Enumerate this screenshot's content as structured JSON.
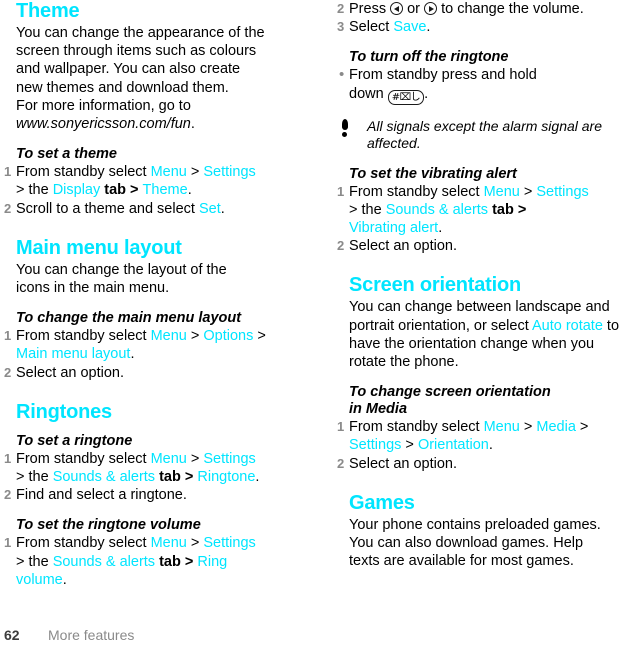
{
  "accent_color": "#00e5ff",
  "muted_color": "#8a8a8a",
  "footer": {
    "page_number": "62",
    "section_label": "More features"
  },
  "left_column": {
    "theme": {
      "heading": "Theme",
      "body_lines": [
        "You can change the appearance of the",
        "screen through items such as colours",
        "and wallpaper. You can also create",
        "new themes and download them.",
        "For more information, go to"
      ],
      "url": "www.sonyericsson.com/fun",
      "url_trailing": ".",
      "task_title": "To set a theme",
      "step1": {
        "num": "1",
        "a": "From standby select ",
        "menu": "Menu",
        "b": " > ",
        "settings": "Settings",
        "c": "> the ",
        "display": "Display",
        "d": " tab > ",
        "theme": "Theme",
        "e": "."
      },
      "step2": {
        "num": "2",
        "a": "Scroll to a theme and select ",
        "set": "Set",
        "b": "."
      }
    },
    "main_menu_layout": {
      "heading": "Main menu layout",
      "body_lines": [
        "You can change the layout of the",
        "icons in the main menu."
      ],
      "task_title": "To change the main menu layout",
      "step1": {
        "num": "1",
        "a": "From standby select ",
        "menu": "Menu",
        "b": " > ",
        "options": "Options",
        "c": " >",
        "layout": "Main menu layout",
        "d": "."
      },
      "step2": {
        "num": "2",
        "a": "Select an option."
      }
    },
    "ringtones": {
      "heading": "Ringtones",
      "task1_title": "To set a ringtone",
      "t1_step1": {
        "num": "1",
        "a": "From standby select ",
        "menu": "Menu",
        "b": " > ",
        "settings": "Settings",
        "c": "> the ",
        "sounds": "Sounds & alerts",
        "d": " tab > ",
        "ringtone": "Ringtone",
        "e": "."
      },
      "t1_step2": {
        "num": "2",
        "a": "Find and select a ringtone."
      },
      "task2_title": "To set the ringtone volume",
      "t2_step1": {
        "num": "1",
        "a": "From standby select ",
        "menu": "Menu",
        "b": " > ",
        "settings": "Settings",
        "c": "> the ",
        "sounds": "Sounds & alerts",
        "d": " tab > ",
        "ring": "Ring",
        "volume": "volume",
        "e": "."
      }
    }
  },
  "right_column": {
    "ringtone_volume_cont": {
      "step2": {
        "num": "2",
        "a": "Press ",
        "b": " or ",
        "c": " to change the volume.",
        "left_key_icon": "nav-left-key-icon",
        "right_key_icon": "nav-right-key-icon"
      },
      "step3": {
        "num": "3",
        "a": "Select ",
        "save": "Save",
        "b": "."
      }
    },
    "turn_off_ringtone": {
      "task_title": "To turn off the ringtone",
      "bullet": "•",
      "line1": "From standby press and hold",
      "line2_prefix": "down ",
      "hash_key_label": "#",
      "hash_key_icon": "hash-key-icon",
      "line2_suffix": "."
    },
    "note": {
      "icon": "exclamation-note-icon",
      "text": "All signals except the alarm signal are affected."
    },
    "vibrating_alert": {
      "task_title": "To set the vibrating alert",
      "step1": {
        "num": "1",
        "a": "From standby select ",
        "menu": "Menu",
        "b": " > ",
        "settings": "Settings",
        "c": "> the ",
        "sounds": "Sounds & alerts",
        "d": " tab >",
        "vibrating": "Vibrating alert",
        "e": "."
      },
      "step2": {
        "num": "2",
        "a": "Select an option."
      }
    },
    "screen_orientation": {
      "heading": "Screen orientation",
      "body_a": "You can change between landscape and portrait orientation, or select ",
      "auto_rotate": "Auto rotate",
      "body_b": " to have the orientation change when you rotate the phone.",
      "task_title_line1": "To change screen orientation",
      "task_title_line2": "in Media",
      "step1": {
        "num": "1",
        "a": "From standby select ",
        "menu": "Menu",
        "b": " > ",
        "media": "Media",
        "c": " > ",
        "settings": "Settings",
        "d": " > ",
        "orientation": "Orientation",
        "e": "."
      },
      "step2": {
        "num": "2",
        "a": "Select an option."
      }
    },
    "games": {
      "heading": "Games",
      "body_lines": [
        "Your phone contains preloaded games.",
        "You can also download games. Help",
        "texts are available for most games."
      ]
    }
  }
}
